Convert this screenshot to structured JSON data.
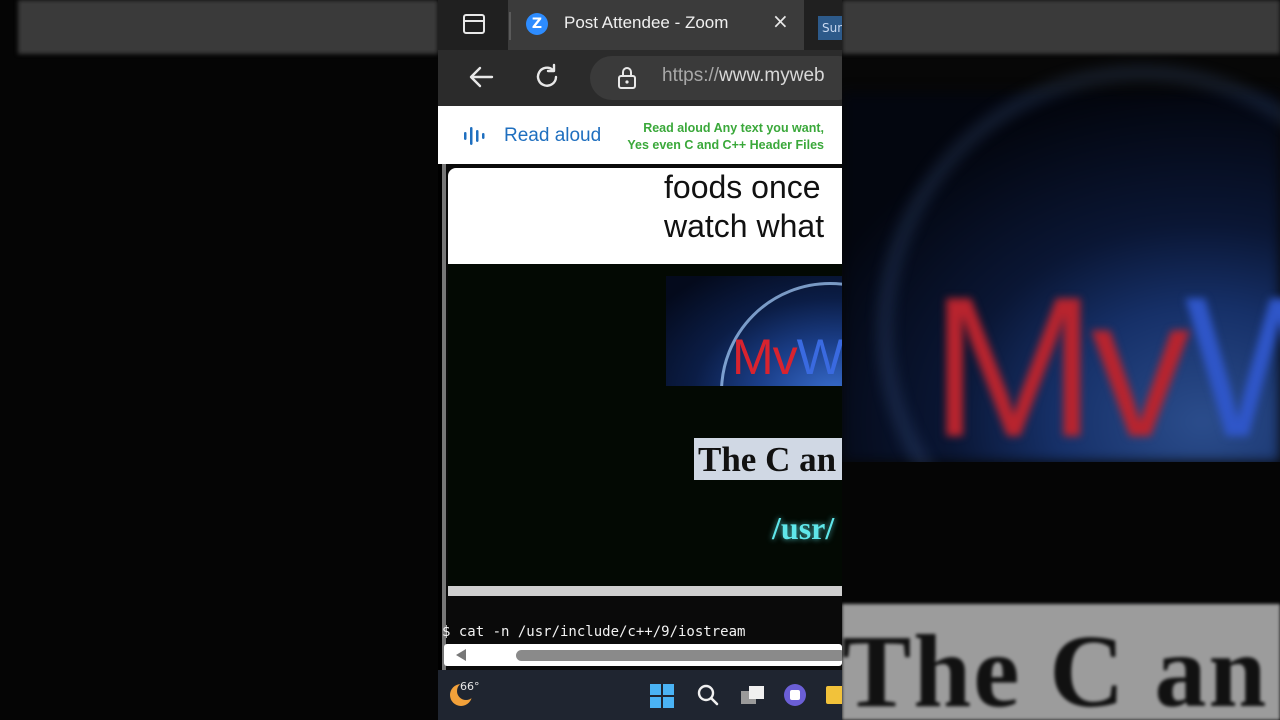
{
  "browser": {
    "tab_title": "Post Attendee - Zoom",
    "tab_logo_letter": "Z",
    "tab_close_glyph": "×",
    "next_tab_label": "Sun",
    "url_scheme": "https://",
    "url_host": "www.myweb"
  },
  "read_aloud": {
    "label": "Read aloud",
    "note_line1": "Read aloud Any text you want,",
    "note_line2": "Yes even  C and C++ Header Files",
    "accent_color": "#1f6fbf",
    "note_color": "#3aa83a"
  },
  "page": {
    "text_line1": "foods once",
    "text_line2": "watch what",
    "logo_red": "Mv",
    "logo_blue": "W",
    "title_badge": "The C an",
    "path_text": "/usr/",
    "terminal_line": "$ cat -n /usr/include/c++/9/iostream"
  },
  "backdrop": {
    "logo_red": "Mv",
    "logo_blue": "W",
    "banner_text": "The C an"
  },
  "taskbar": {
    "temperature": "66°"
  },
  "icons": [
    "sidebar-toggle-icon",
    "zoom-logo-icon",
    "close-icon",
    "back-arrow-icon",
    "reload-icon",
    "lock-icon",
    "read-aloud-icon",
    "weather-icon",
    "windows-start-icon",
    "search-icon",
    "task-view-icon",
    "chat-icon",
    "file-explorer-icon"
  ]
}
